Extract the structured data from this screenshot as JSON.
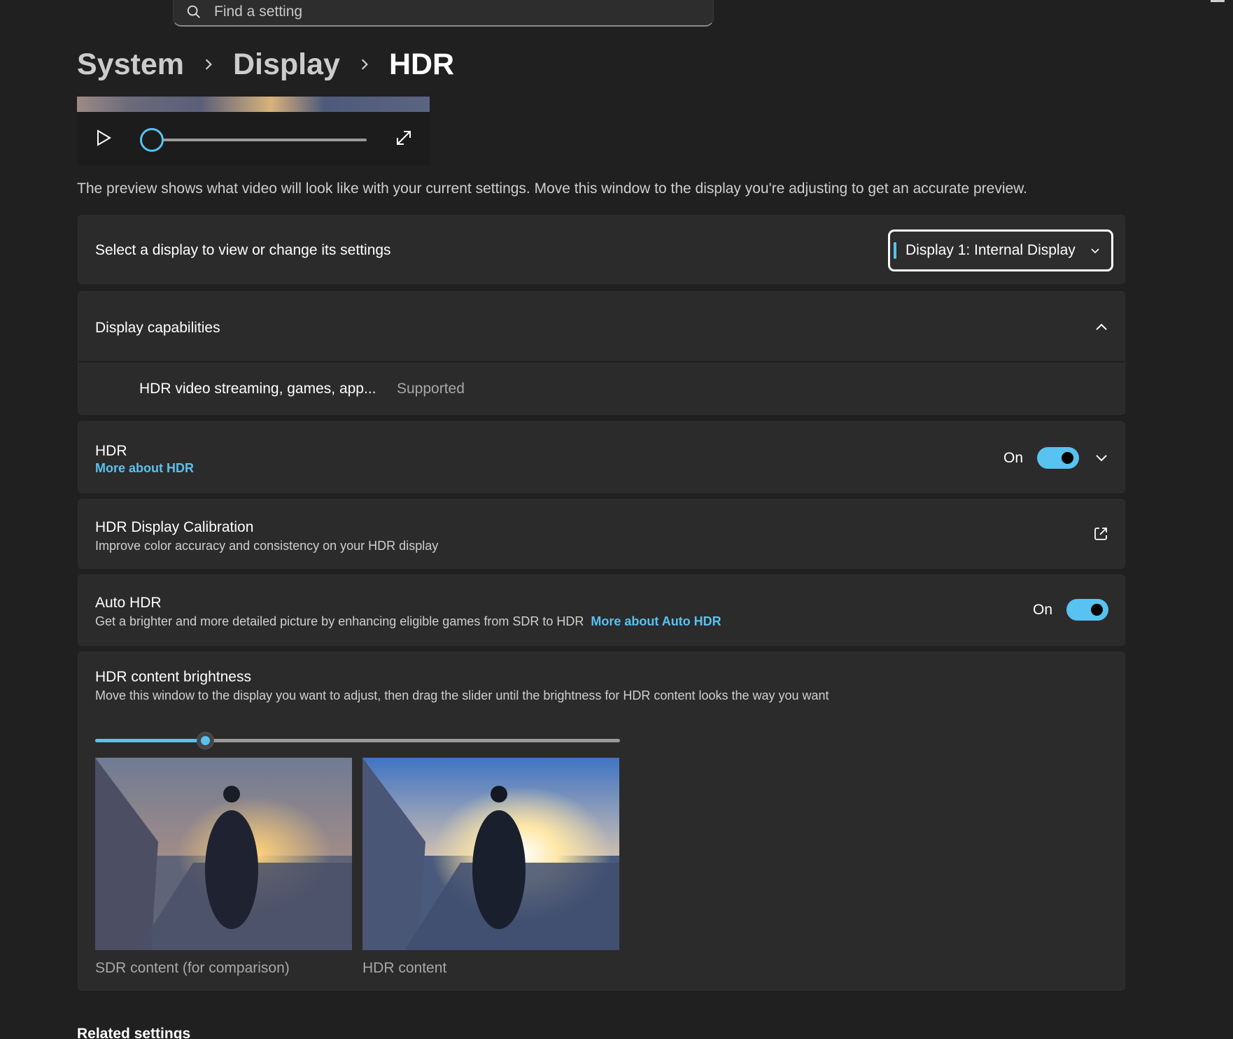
{
  "search": {
    "placeholder": "Find a setting",
    "icon": "search-icon"
  },
  "breadcrumb": {
    "items": [
      "System",
      "Display"
    ],
    "current": "HDR"
  },
  "video": {
    "progress_percent": 0
  },
  "preview_text": "The preview shows what video will look like with your current settings. Move this window to the display you're adjusting to get an accurate preview.",
  "select_display": {
    "label": "Select a display to view or change its settings",
    "selected": "Display 1: Internal Display"
  },
  "capabilities": {
    "title": "Display capabilities",
    "rows": [
      {
        "name": "HDR video streaming, games, app...",
        "value": "Supported"
      }
    ]
  },
  "hdr": {
    "title": "HDR",
    "link": "More about HDR",
    "state": "On"
  },
  "calibration": {
    "title": "HDR Display Calibration",
    "desc": "Improve color accuracy and consistency on your HDR display"
  },
  "auto_hdr": {
    "title": "Auto HDR",
    "desc": "Get a brighter and more detailed picture by enhancing eligible games from SDR to HDR",
    "link": "More about Auto HDR",
    "state": "On"
  },
  "brightness": {
    "title": "HDR content brightness",
    "desc": "Move this window to the display you want to adjust, then drag the slider until the brightness for HDR content looks the way you want",
    "slider_percent": 21,
    "sdr_caption": "SDR content (for comparison)",
    "hdr_caption": "HDR content"
  },
  "related": {
    "title": "Related settings"
  },
  "colors": {
    "accent": "#58c2f0",
    "background": "#202020",
    "card": "#2b2b2b"
  }
}
